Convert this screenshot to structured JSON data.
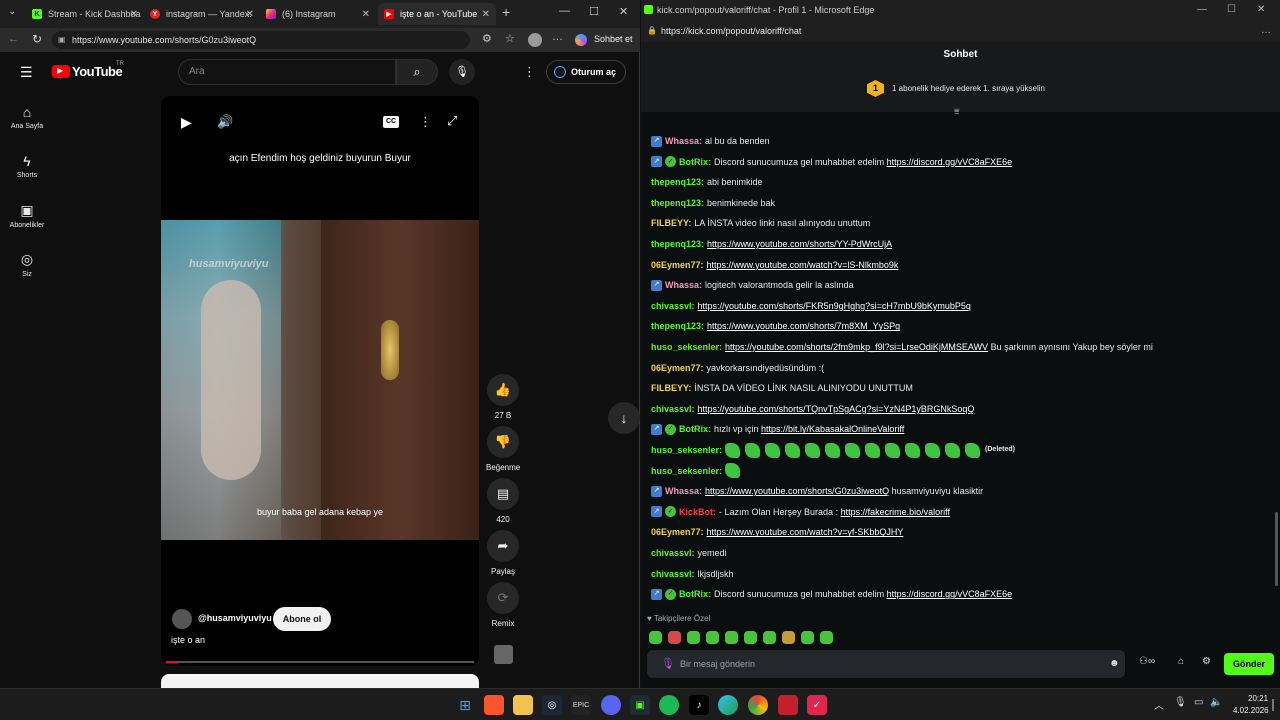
{
  "left_browser": {
    "tabs": [
      {
        "label": "Stream - Kick Dashboa",
        "icon": "kick-icon"
      },
      {
        "label": "instagram — Yandex:",
        "icon": "yandex-icon"
      },
      {
        "label": "(6) Instagram",
        "icon": "instagram-icon"
      },
      {
        "label": "işte o an - YouTube",
        "icon": "youtube-icon"
      }
    ],
    "url": "https://www.youtube.com/shorts/G0zu3iweotQ",
    "sohbet_label": "Sohbet et"
  },
  "youtube": {
    "logo": "YouTube",
    "logo_region": "TR",
    "search_placeholder": "Ara",
    "signin_label": "Oturum aç",
    "sidebar": [
      {
        "label": "Ana Sayfa",
        "icon": "home-icon"
      },
      {
        "label": "Shorts",
        "icon": "shorts-icon"
      },
      {
        "label": "Abonelikler",
        "icon": "subscriptions-icon"
      },
      {
        "label": "Siz",
        "icon": "you-icon"
      }
    ],
    "caption_top": "açın Efendim hoş geldiniz buyurun Buyur",
    "watermark": "husamviyuviyu",
    "caption_bottom": "buyur baba gel adana kebap ye",
    "channel": "@husamviyuviyu",
    "subscribe_label": "Abone ol",
    "video_title": "işte o an",
    "actions": [
      {
        "label": "27 B",
        "icon": "thumbs-up-icon"
      },
      {
        "label": "Beğenme",
        "icon": "thumbs-down-icon"
      },
      {
        "label": "420",
        "icon": "comment-icon"
      },
      {
        "label": "Paylaş",
        "icon": "share-icon"
      },
      {
        "label": "Remix",
        "icon": "remix-icon"
      }
    ],
    "progress_fraction": 0.04
  },
  "right_browser": {
    "window_title": "kick.com/popout/valoriff/chat - Profil 1 - Microsoft Edge",
    "url": "https://kick.com/popout/valoriff/chat"
  },
  "chat": {
    "header": "Sohbet",
    "promo_rank": "1",
    "promo_text": "1 abonelik hediye ederek 1. sıraya yükselin",
    "messages": [
      {
        "user": "Whassa:",
        "color": "#f49bb9",
        "badges": [
          "bot"
        ],
        "text": "al bu da benden",
        "link": ""
      },
      {
        "user": "BotRix:",
        "color": "#53fc18",
        "badges": [
          "bot",
          "verified"
        ],
        "text": "Discord sunucumuza gel muhabbet edelim ",
        "link": "https://discord.gg/vVC8aFXE6e"
      },
      {
        "user": "thepenq123:",
        "color": "#53fc18",
        "badges": [],
        "text": "abi benimkide",
        "link": ""
      },
      {
        "user": "thepenq123:",
        "color": "#53fc18",
        "badges": [],
        "text": "benimkinede bak",
        "link": ""
      },
      {
        "user": "FILBEYY:",
        "color": "#f5d442",
        "badges": [],
        "text": "LA İNSTA video linki nasıl alınıyodu unuttum",
        "link": ""
      },
      {
        "user": "thepenq123:",
        "color": "#53fc18",
        "badges": [],
        "text": "",
        "link": "https://www.youtube.com/shorts/YY-PdWrcUjA"
      },
      {
        "user": "06Eymen77:",
        "color": "#f5d442",
        "badges": [],
        "text": "",
        "link": "https://www.youtube.com/watch?v=lS-Nlkmbo9k"
      },
      {
        "user": "Whassa:",
        "color": "#f49bb9",
        "badges": [
          "bot"
        ],
        "text": "logitech valorantmoda gelir la aslında",
        "link": ""
      },
      {
        "user": "chivassvl:",
        "color": "#53fc18",
        "badges": [],
        "text": "",
        "link": "https://youtube.com/shorts/FKR5n9gHghg?si=cH7mbU9bKymubP5q"
      },
      {
        "user": "thepenq123:",
        "color": "#53fc18",
        "badges": [],
        "text": "",
        "link": "https://www.youtube.com/shorts/7m8XM_YySPg"
      },
      {
        "user": "huso_seksenler:",
        "color": "#53fc18",
        "badges": [],
        "text": "",
        "link": "https://youtube.com/shorts/2fm9mkp_f9l?si=LrseOdiKjMMSEAWV",
        "after": " Bu şarkının aynısını Yakup bey söyler mi"
      },
      {
        "user": "06Eymen77:",
        "color": "#f5d442",
        "badges": [],
        "text": "yavkorkarsındiyedüsündüm :(",
        "link": ""
      },
      {
        "user": "FILBEYY:",
        "color": "#f5d442",
        "badges": [],
        "text": "İNSTA DA VİDEO LİNK NASIL ALINIYODU UNUTTUM",
        "link": ""
      },
      {
        "user": "chivassvl:",
        "color": "#53fc18",
        "badges": [],
        "text": "",
        "link": "https://youtube.com/shorts/TQnvTpSgACg?si=YzN4P1yBRGNkSoqQ"
      },
      {
        "user": "BotRix:",
        "color": "#53fc18",
        "badges": [
          "bot",
          "verified"
        ],
        "text": "hızlı vp için ",
        "link": "https://bit.ly/KabasakalOnlineValoriff"
      },
      {
        "user": "huso_seksenler:",
        "color": "#53fc18",
        "badges": [],
        "text": "",
        "link": "",
        "emotes": 13,
        "after": "(Deleted)"
      },
      {
        "user": "huso_seksenler:",
        "color": "#53fc18",
        "badges": [],
        "text": "",
        "link": "",
        "emotes": 1
      },
      {
        "user": "Whassa:",
        "color": "#f49bb9",
        "badges": [
          "bot"
        ],
        "text": "",
        "link": "https://www.youtube.com/shorts/G0zu3iweotQ",
        "after": " husamviyuviyu klasiktir"
      },
      {
        "user": "KickBot:",
        "color": "#ff3b3b",
        "badges": [
          "bot",
          "verified"
        ],
        "text": "- Lazım Olan Herşey Burada : ",
        "link": "https://fakecrime.bio/valoriff"
      },
      {
        "user": "06Eymen77:",
        "color": "#f5d442",
        "badges": [],
        "text": "",
        "link": "https://www.youtube.com/watch?v=yf-SKbbQJHY"
      },
      {
        "user": "chivassvl:",
        "color": "#53fc18",
        "badges": [],
        "text": "yemedi",
        "link": ""
      },
      {
        "user": "chivassvl:",
        "color": "#53fc18",
        "badges": [],
        "text": "lkjsdljskh",
        "link": ""
      },
      {
        "user": "BotRix:",
        "color": "#53fc18",
        "badges": [
          "bot",
          "verified"
        ],
        "text": "Discord sunucumuza gel muhabbet edelim ",
        "link": "https://discord.gg/vVC8aFXE6e"
      }
    ],
    "followers_label": "Takipçilere Özel",
    "input_placeholder": "Bir mesaj gönderin",
    "send_label": "Gönder"
  },
  "taskbar": {
    "time": "20:21",
    "date": "4.02.2026"
  }
}
